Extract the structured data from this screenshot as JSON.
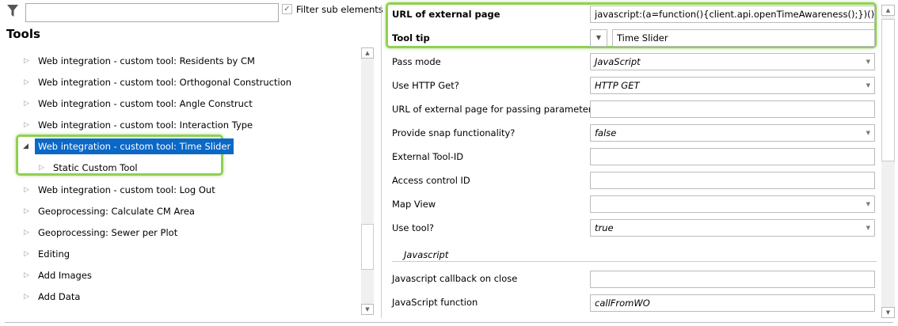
{
  "filter": {
    "value": "",
    "checkbox_label": "Filter sub elements",
    "checked": true
  },
  "tree": {
    "title": "Tools",
    "items": [
      {
        "label": "Web integration - custom tool: Residents by CM"
      },
      {
        "label": "Web integration - custom tool: Orthogonal Construction"
      },
      {
        "label": "Web integration - custom tool: Angle Construct"
      },
      {
        "label": "Web integration - custom tool: Interaction Type"
      },
      {
        "label": "Web integration - custom tool: Time Slider",
        "selected": true,
        "expanded": true
      },
      {
        "label": "Static Custom Tool",
        "child": true
      },
      {
        "label": "Web integration - custom tool: Log Out"
      },
      {
        "label": "Geoprocessing: Calculate CM Area"
      },
      {
        "label": "Geoprocessing: Sewer per Plot"
      },
      {
        "label": "Editing"
      },
      {
        "label": "Add Images"
      },
      {
        "label": "Add Data"
      }
    ]
  },
  "properties": {
    "url": {
      "label": "URL of external page",
      "value": "javascript:(a=function(){client.api.openTimeAwareness();})()"
    },
    "tooltip": {
      "label": "Tool tip",
      "value": "Time Slider"
    },
    "pass_mode": {
      "label": "Pass mode",
      "value": "JavaScript"
    },
    "http_get": {
      "label": "Use HTTP Get?",
      "value": "HTTP GET"
    },
    "url_params": {
      "label": "URL of external page for passing parameters",
      "value": ""
    },
    "snap": {
      "label": "Provide snap functionality?",
      "value": "false"
    },
    "tool_id": {
      "label": "External Tool-ID",
      "value": ""
    },
    "access_id": {
      "label": "Access control ID",
      "value": ""
    },
    "map_view": {
      "label": "Map View",
      "value": ""
    },
    "use_tool": {
      "label": "Use tool?",
      "value": "true"
    },
    "section": "Javascript",
    "js_callback": {
      "label": "Javascript callback on close",
      "value": ""
    },
    "js_function": {
      "label": "JavaScript function",
      "value": "callFromWO"
    }
  },
  "colors": {
    "selection": "#0a68c6",
    "highlight": "#8fd14f"
  }
}
